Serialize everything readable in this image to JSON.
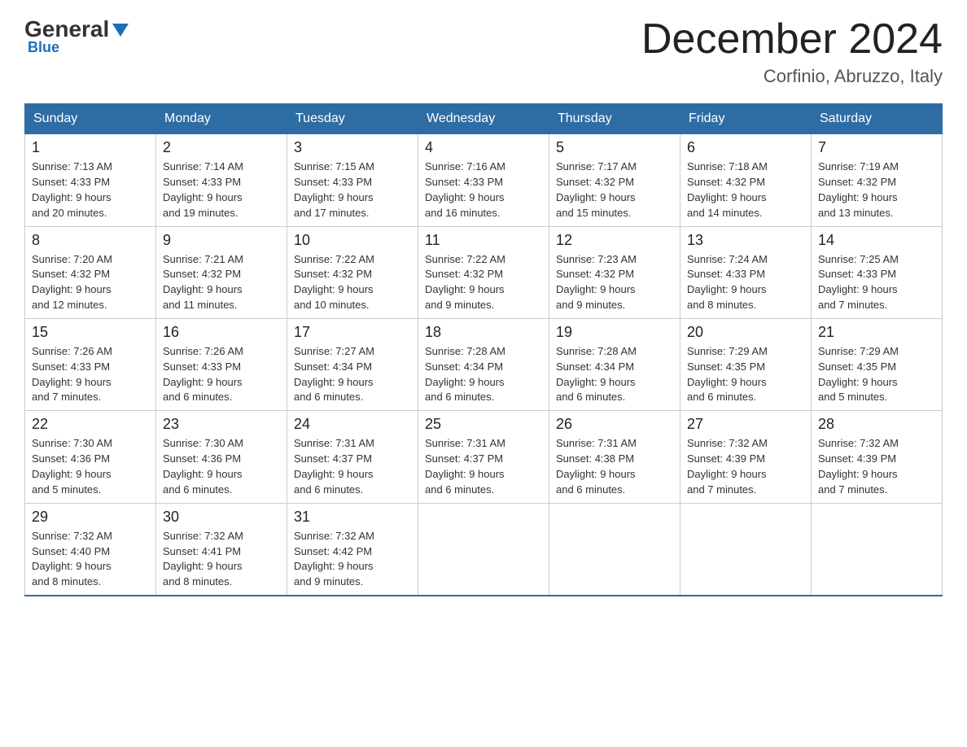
{
  "header": {
    "logo_general": "General",
    "logo_arrow": "▶",
    "logo_blue": "Blue",
    "title": "December 2024",
    "subtitle": "Corfinio, Abruzzo, Italy"
  },
  "columns": [
    "Sunday",
    "Monday",
    "Tuesday",
    "Wednesday",
    "Thursday",
    "Friday",
    "Saturday"
  ],
  "weeks": [
    [
      {
        "day": "1",
        "sunrise": "7:13 AM",
        "sunset": "4:33 PM",
        "daylight": "9 hours and 20 minutes."
      },
      {
        "day": "2",
        "sunrise": "7:14 AM",
        "sunset": "4:33 PM",
        "daylight": "9 hours and 19 minutes."
      },
      {
        "day": "3",
        "sunrise": "7:15 AM",
        "sunset": "4:33 PM",
        "daylight": "9 hours and 17 minutes."
      },
      {
        "day": "4",
        "sunrise": "7:16 AM",
        "sunset": "4:33 PM",
        "daylight": "9 hours and 16 minutes."
      },
      {
        "day": "5",
        "sunrise": "7:17 AM",
        "sunset": "4:32 PM",
        "daylight": "9 hours and 15 minutes."
      },
      {
        "day": "6",
        "sunrise": "7:18 AM",
        "sunset": "4:32 PM",
        "daylight": "9 hours and 14 minutes."
      },
      {
        "day": "7",
        "sunrise": "7:19 AM",
        "sunset": "4:32 PM",
        "daylight": "9 hours and 13 minutes."
      }
    ],
    [
      {
        "day": "8",
        "sunrise": "7:20 AM",
        "sunset": "4:32 PM",
        "daylight": "9 hours and 12 minutes."
      },
      {
        "day": "9",
        "sunrise": "7:21 AM",
        "sunset": "4:32 PM",
        "daylight": "9 hours and 11 minutes."
      },
      {
        "day": "10",
        "sunrise": "7:22 AM",
        "sunset": "4:32 PM",
        "daylight": "9 hours and 10 minutes."
      },
      {
        "day": "11",
        "sunrise": "7:22 AM",
        "sunset": "4:32 PM",
        "daylight": "9 hours and 9 minutes."
      },
      {
        "day": "12",
        "sunrise": "7:23 AM",
        "sunset": "4:32 PM",
        "daylight": "9 hours and 9 minutes."
      },
      {
        "day": "13",
        "sunrise": "7:24 AM",
        "sunset": "4:33 PM",
        "daylight": "9 hours and 8 minutes."
      },
      {
        "day": "14",
        "sunrise": "7:25 AM",
        "sunset": "4:33 PM",
        "daylight": "9 hours and 7 minutes."
      }
    ],
    [
      {
        "day": "15",
        "sunrise": "7:26 AM",
        "sunset": "4:33 PM",
        "daylight": "9 hours and 7 minutes."
      },
      {
        "day": "16",
        "sunrise": "7:26 AM",
        "sunset": "4:33 PM",
        "daylight": "9 hours and 6 minutes."
      },
      {
        "day": "17",
        "sunrise": "7:27 AM",
        "sunset": "4:34 PM",
        "daylight": "9 hours and 6 minutes."
      },
      {
        "day": "18",
        "sunrise": "7:28 AM",
        "sunset": "4:34 PM",
        "daylight": "9 hours and 6 minutes."
      },
      {
        "day": "19",
        "sunrise": "7:28 AM",
        "sunset": "4:34 PM",
        "daylight": "9 hours and 6 minutes."
      },
      {
        "day": "20",
        "sunrise": "7:29 AM",
        "sunset": "4:35 PM",
        "daylight": "9 hours and 6 minutes."
      },
      {
        "day": "21",
        "sunrise": "7:29 AM",
        "sunset": "4:35 PM",
        "daylight": "9 hours and 5 minutes."
      }
    ],
    [
      {
        "day": "22",
        "sunrise": "7:30 AM",
        "sunset": "4:36 PM",
        "daylight": "9 hours and 5 minutes."
      },
      {
        "day": "23",
        "sunrise": "7:30 AM",
        "sunset": "4:36 PM",
        "daylight": "9 hours and 6 minutes."
      },
      {
        "day": "24",
        "sunrise": "7:31 AM",
        "sunset": "4:37 PM",
        "daylight": "9 hours and 6 minutes."
      },
      {
        "day": "25",
        "sunrise": "7:31 AM",
        "sunset": "4:37 PM",
        "daylight": "9 hours and 6 minutes."
      },
      {
        "day": "26",
        "sunrise": "7:31 AM",
        "sunset": "4:38 PM",
        "daylight": "9 hours and 6 minutes."
      },
      {
        "day": "27",
        "sunrise": "7:32 AM",
        "sunset": "4:39 PM",
        "daylight": "9 hours and 7 minutes."
      },
      {
        "day": "28",
        "sunrise": "7:32 AM",
        "sunset": "4:39 PM",
        "daylight": "9 hours and 7 minutes."
      }
    ],
    [
      {
        "day": "29",
        "sunrise": "7:32 AM",
        "sunset": "4:40 PM",
        "daylight": "9 hours and 8 minutes."
      },
      {
        "day": "30",
        "sunrise": "7:32 AM",
        "sunset": "4:41 PM",
        "daylight": "9 hours and 8 minutes."
      },
      {
        "day": "31",
        "sunrise": "7:32 AM",
        "sunset": "4:42 PM",
        "daylight": "9 hours and 9 minutes."
      },
      null,
      null,
      null,
      null
    ]
  ]
}
